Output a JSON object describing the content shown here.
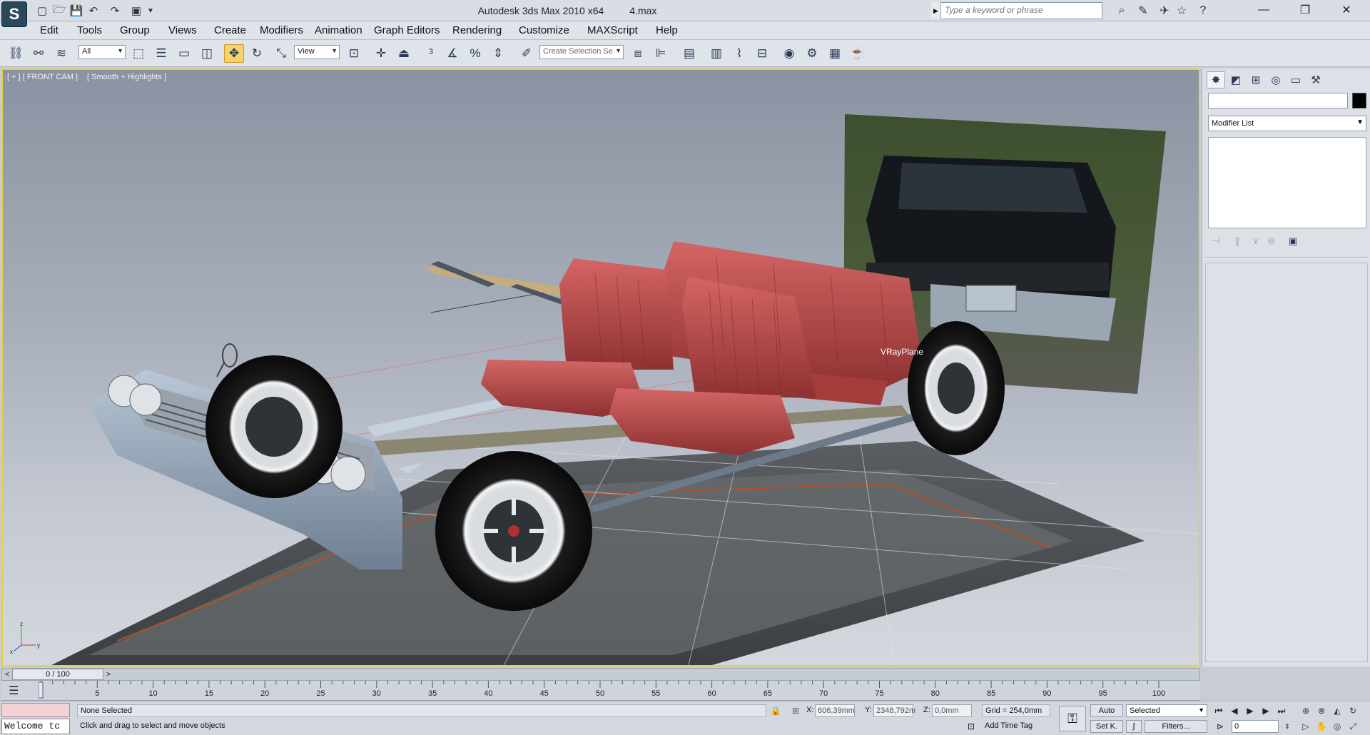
{
  "window": {
    "title": "Autodesk 3ds Max  2010 x64",
    "filename": "4.max",
    "search_placeholder": "Type a keyword or phrase"
  },
  "menu": [
    "Edit",
    "Tools",
    "Group",
    "Views",
    "Create",
    "Modifiers",
    "Animation",
    "Graph Editors",
    "Rendering",
    "Customize",
    "MAXScript",
    "Help"
  ],
  "toolbar": {
    "filter_value": "All",
    "refcoord_value": "View",
    "named_selection_placeholder": "Create Selection Se"
  },
  "viewport": {
    "label": "[ + ] [ FRONT CAM ]",
    "shading": "[ Smooth + Highlights ]",
    "object_label": "VRayPlane"
  },
  "command_panel": {
    "modifier_list": "Modifier List",
    "object_color": "#000000"
  },
  "timeline": {
    "frame_display": "0 / 100",
    "ticks": [
      "5",
      "10",
      "15",
      "20",
      "25",
      "30",
      "35",
      "40",
      "45",
      "50",
      "55",
      "60",
      "65",
      "70",
      "75",
      "80",
      "85",
      "90",
      "95",
      "100"
    ]
  },
  "status": {
    "listener_text": "Welcome tc",
    "selection": "None Selected",
    "prompt": "Click and drag to select and move objects",
    "x_label": "X:",
    "x_value": "606,39mm",
    "y_label": "Y:",
    "y_value": "2348,792m",
    "z_label": "Z:",
    "z_value": "0,0mm",
    "grid": "Grid = 254,0mm",
    "add_time_tag": "Add Time Tag",
    "auto_key": "Auto",
    "set_key": "Set K.",
    "key_filter_dd": "Selected",
    "filters": "Filters...",
    "current_frame": "0"
  },
  "colors": {
    "viewport_border": "#e8d23a",
    "active_tool": "#f5d36a",
    "seat": "#b84848",
    "car_body": "#8fa2b6"
  }
}
